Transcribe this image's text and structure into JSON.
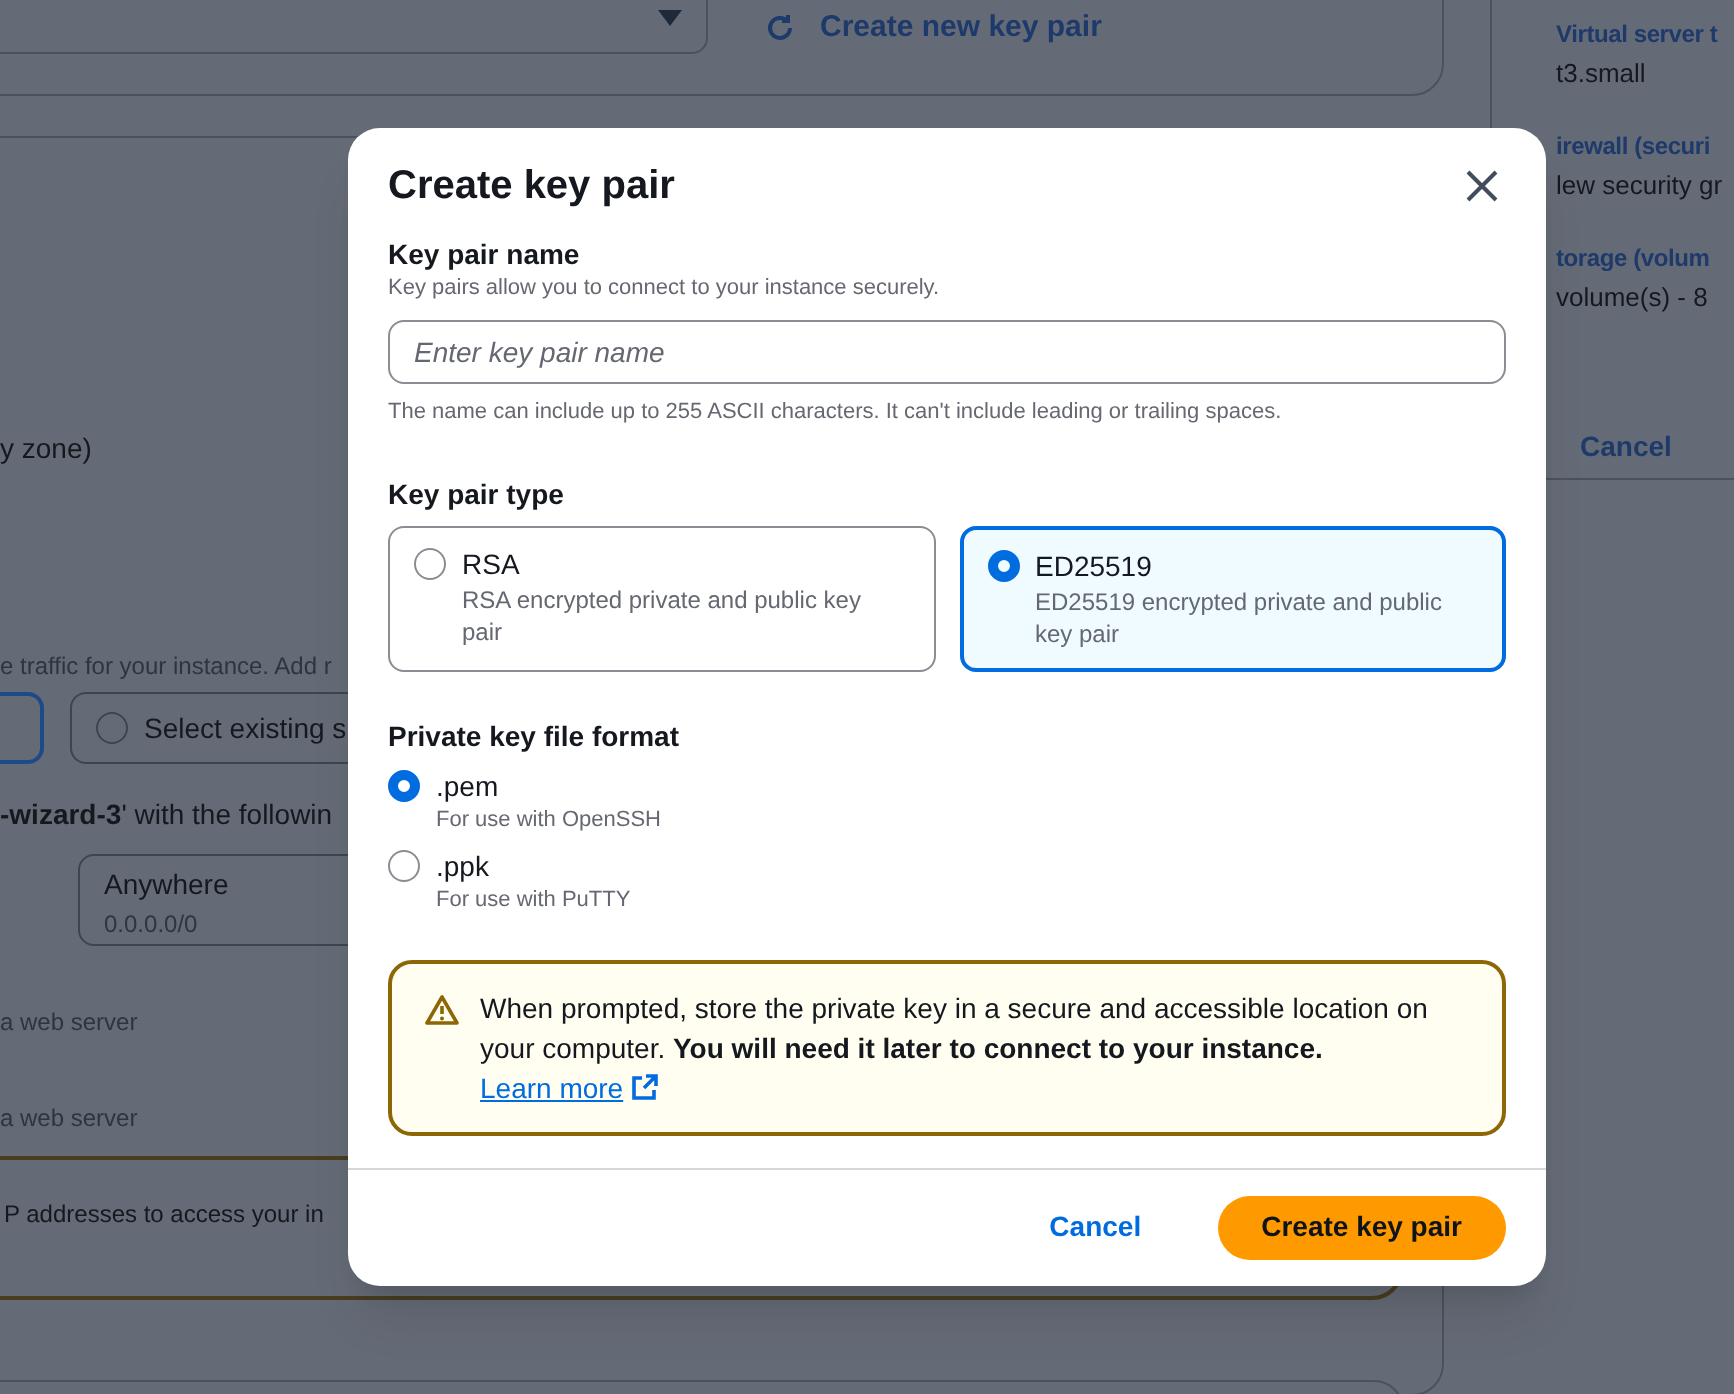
{
  "background": {
    "create_key_link": "Create new key pair",
    "zone_fragment": "y zone)",
    "firewall_hint": "e traffic for your instance. Add r",
    "security_group_option": "Select existing s",
    "rules_intro": "**-wizard-3**' with the followin",
    "source": {
      "label": "Anywhere",
      "value": "0.0.0.0/0"
    },
    "rule_hints": [
      "a web server",
      "a web server"
    ],
    "warning_fragment": "P addresses to access your in",
    "summary": [
      {
        "label": "Virtual server t",
        "value": "t3.small"
      },
      {
        "label": "irewall (securi",
        "value": "lew security gr"
      },
      {
        "label": "torage (volum",
        "value": "volume(s) - 8"
      }
    ],
    "cancel": "Cancel"
  },
  "dialog": {
    "title": "Create key pair",
    "name_field": {
      "label": "Key pair name",
      "description": "Key pairs allow you to connect to your instance securely.",
      "placeholder": "Enter key pair name",
      "constraint": "The name can include up to 255 ASCII characters. It can't include leading or trailing spaces."
    },
    "key_pair_type": {
      "label": "Key pair type",
      "options": [
        {
          "label": "RSA",
          "description": "RSA encrypted private and public key pair",
          "selected": false
        },
        {
          "label": "ED25519",
          "description": "ED25519 encrypted private and public key pair",
          "selected": true
        }
      ]
    },
    "file_format": {
      "label": "Private key file format",
      "options": [
        {
          "label": ".pem",
          "description": "For use with OpenSSH",
          "selected": true
        },
        {
          "label": ".ppk",
          "description": "For use with PuTTY",
          "selected": false
        }
      ]
    },
    "alert": {
      "text": "When prompted, store the private key in a secure and accessible location on your computer. **You will need it later to connect to your instance.**",
      "link": "Learn more"
    },
    "buttons": {
      "cancel": "Cancel",
      "primary": "Create key pair"
    }
  }
}
